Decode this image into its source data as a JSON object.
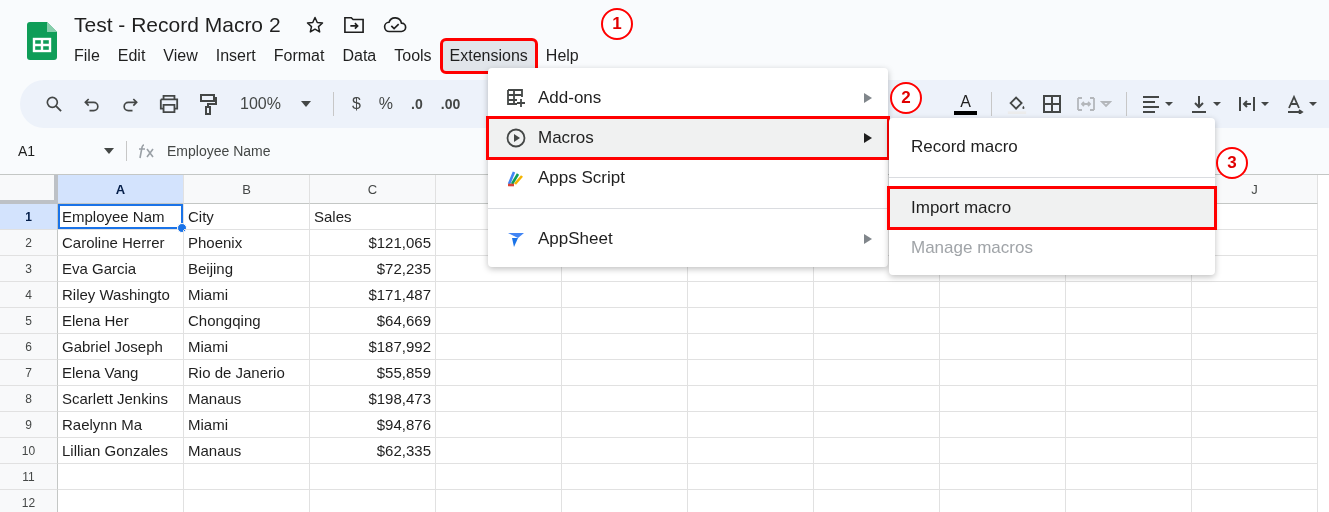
{
  "document": {
    "title": "Test - Record Macro 2"
  },
  "menu_bar": [
    {
      "label": "File",
      "selected": false,
      "highlighted": false
    },
    {
      "label": "Edit",
      "selected": false,
      "highlighted": false
    },
    {
      "label": "View",
      "selected": false,
      "highlighted": false
    },
    {
      "label": "Insert",
      "selected": false,
      "highlighted": false
    },
    {
      "label": "Format",
      "selected": false,
      "highlighted": false
    },
    {
      "label": "Data",
      "selected": false,
      "highlighted": false
    },
    {
      "label": "Tools",
      "selected": false,
      "highlighted": false
    },
    {
      "label": "Extensions",
      "selected": true,
      "highlighted": true
    },
    {
      "label": "Help",
      "selected": false,
      "highlighted": false
    }
  ],
  "toolbar": {
    "zoom": "100%",
    "currency": "$",
    "percent": "%",
    "decrease_decimals": ".0",
    "increase_decimals": ".00",
    "text_color": "A"
  },
  "formula_bar": {
    "cell_ref": "A1",
    "content": "Employee Name"
  },
  "sheet": {
    "columns": [
      {
        "label": "A",
        "selected": true
      },
      {
        "label": "B",
        "selected": false
      },
      {
        "label": "C",
        "selected": false
      },
      {
        "label": "J",
        "selected": false
      }
    ],
    "rows": [
      {
        "number": "1",
        "selected": true,
        "cells": [
          "Employee Nam",
          "City",
          "Sales"
        ]
      },
      {
        "number": "2",
        "selected": false,
        "cells": [
          "Caroline Herrer",
          "Phoenix",
          "$121,065"
        ]
      },
      {
        "number": "3",
        "selected": false,
        "cells": [
          "Eva Garcia",
          "Beijing",
          "$72,235"
        ]
      },
      {
        "number": "4",
        "selected": false,
        "cells": [
          "Riley Washingto",
          "Miami",
          "$171,487"
        ]
      },
      {
        "number": "5",
        "selected": false,
        "cells": [
          "Elena Her",
          "Chongqing",
          "$64,669"
        ]
      },
      {
        "number": "6",
        "selected": false,
        "cells": [
          "Gabriel Joseph",
          "Miami",
          "$187,992"
        ]
      },
      {
        "number": "7",
        "selected": false,
        "cells": [
          "Elena Vang",
          "Rio de Janerio",
          "$55,859"
        ]
      },
      {
        "number": "8",
        "selected": false,
        "cells": [
          "Scarlett Jenkins",
          "Manaus",
          "$198,473"
        ]
      },
      {
        "number": "9",
        "selected": false,
        "cells": [
          "Raelynn Ma",
          "Miami",
          "$94,876"
        ]
      },
      {
        "number": "10",
        "selected": false,
        "cells": [
          "Lillian Gonzales",
          "Manaus",
          "$62,335"
        ]
      },
      {
        "number": "11",
        "selected": false,
        "cells": []
      },
      {
        "number": "12",
        "selected": false,
        "cells": []
      }
    ]
  },
  "extensions_menu": [
    {
      "kind": "addons",
      "label": "Add-ons",
      "selected": false,
      "highlighted": false,
      "submenu": true
    },
    {
      "kind": "macros",
      "label": "Macros",
      "selected": true,
      "highlighted": true,
      "submenu": true
    },
    {
      "kind": "script",
      "label": "Apps Script",
      "selected": false,
      "highlighted": false,
      "submenu": false
    },
    {
      "kind": "appsheet",
      "label": "AppSheet",
      "selected": false,
      "highlighted": false,
      "submenu": true
    }
  ],
  "macros_submenu": [
    {
      "label": "Record macro",
      "selected": false,
      "highlighted": false,
      "disabled": false
    },
    {
      "label": "Import macro",
      "selected": true,
      "highlighted": true,
      "disabled": false
    },
    {
      "label": "Manage macros",
      "selected": false,
      "highlighted": false,
      "disabled": true
    }
  ],
  "callouts": [
    "1",
    "2",
    "3"
  ]
}
